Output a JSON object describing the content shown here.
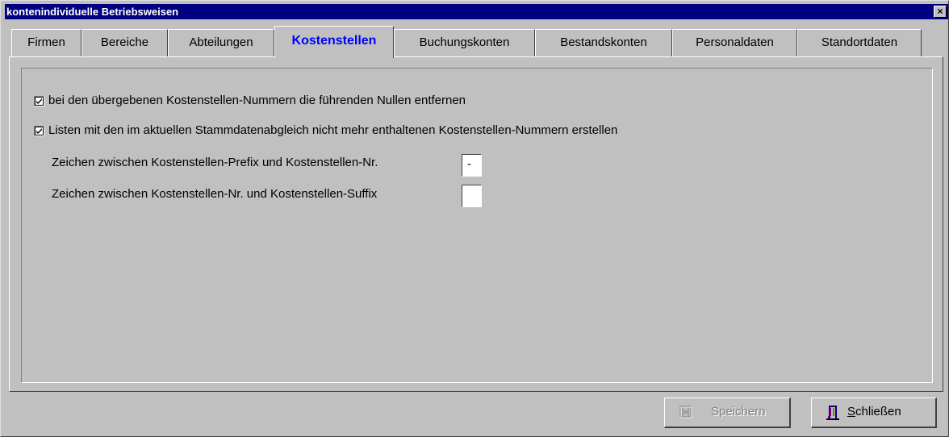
{
  "window": {
    "title": "kontenindividuelle Betriebsweisen",
    "close_label": "×"
  },
  "tabs": [
    {
      "label": "Firmen",
      "active": false
    },
    {
      "label": "Bereiche",
      "active": false
    },
    {
      "label": "Abteilungen",
      "active": false
    },
    {
      "label": "Kostenstellen",
      "active": true
    },
    {
      "label": "Buchungskonten",
      "active": false
    },
    {
      "label": "Bestandskonten",
      "active": false
    },
    {
      "label": "Personaldaten",
      "active": false
    },
    {
      "label": "Standortdaten",
      "active": false
    }
  ],
  "options": {
    "strip_zeros": {
      "label": "bei den übergebenen Kostenstellen-Nummern die führenden Nullen entfernen",
      "checked": true
    },
    "create_lists": {
      "label": "Listen mit den im aktuellen Stammdatenabgleich nicht mehr enthaltenen Kostenstellen-Nummern erstellen",
      "checked": true
    }
  },
  "fields": {
    "prefix_separator": {
      "label": "Zeichen zwischen Kostenstellen-Prefix und Kostenstellen-Nr.",
      "value": "-"
    },
    "suffix_separator": {
      "label": "Zeichen zwischen Kostenstellen-Nr. und Kostenstellen-Suffix",
      "value": ""
    }
  },
  "buttons": {
    "save": {
      "label": "Speichern",
      "enabled": false,
      "icon": "floppy-disk-icon"
    },
    "close": {
      "label": "Schließen",
      "enabled": true,
      "icon": "door-exit-icon"
    }
  },
  "colors": {
    "titlebar": "#000080",
    "active_tab_text": "#0000ff",
    "face": "#c0c0c0"
  }
}
